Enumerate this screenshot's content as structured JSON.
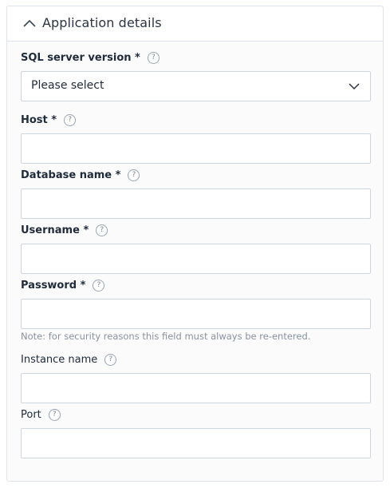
{
  "section": {
    "title": "Application details",
    "toggle_icon": "chevron-up-icon"
  },
  "fields": {
    "sql_server_version": {
      "label": "SQL server version *",
      "value": "Please select",
      "help_icon": "question-circle-icon"
    },
    "host": {
      "label": "Host *",
      "value": "",
      "help_icon": "question-circle-icon"
    },
    "database_name": {
      "label": "Database name *",
      "value": "",
      "help_icon": "question-circle-icon"
    },
    "username": {
      "label": "Username *",
      "value": "",
      "help_icon": "question-circle-icon"
    },
    "password": {
      "label": "Password *",
      "value": "",
      "help_icon": "question-circle-icon",
      "note": "Note: for security reasons this field must always be re-entered."
    },
    "instance_name": {
      "label": "Instance name",
      "value": "",
      "help_icon": "question-circle-icon"
    },
    "port": {
      "label": "Port",
      "value": "",
      "help_icon": "question-circle-icon"
    }
  },
  "help_glyph": "?",
  "colors": {
    "border": "#cfd5de",
    "panel_background": "#fbfbfc",
    "note_text": "#8a929e",
    "help_icon": "#9aa4b2"
  }
}
